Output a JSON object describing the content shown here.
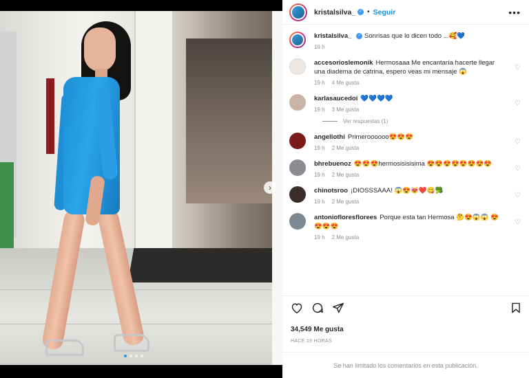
{
  "post": {
    "username": "kristalsilva_",
    "follow_label": "Seguir",
    "separator": "•",
    "verified_mark": "✓",
    "more_icon": "•••",
    "caption_text": "Sonrisas que lo dicen todo ...🥰💙",
    "caption_time": "19 h",
    "likes": "34,549 Me gusta",
    "posted_ago": "HACE 19 HORAS",
    "comments_limited": "Se han limitado los comentarios en esta publicación.",
    "carousel_next": "›"
  },
  "comments": [
    {
      "user": "accesorioslemonik",
      "text": "Hermosaaa Me encantaría hacerte llegar una diadema de catrina, espero veas mi mensaje 😱",
      "time": "19 h",
      "likes": "4 Me gusta",
      "avatar_color": "#efe6e0"
    },
    {
      "user": "karlasaucedoi",
      "text": "💙💙💙💙",
      "time": "19 h",
      "likes": "3 Me gusta",
      "avatar_color": "#c9b2a6"
    },
    {
      "user": "angellothi",
      "text": "Primeroooooo😍😍😍",
      "time": "19 h",
      "likes": "2 Me gusta",
      "avatar_color": "#7a1a1a"
    },
    {
      "user": "bhrebuenoz",
      "text": "😍😍😍hermosisisisima 😍😍😍😍😍😍😍😍",
      "time": "19 h",
      "likes": "2 Me gusta",
      "avatar_color": "#8a8a90"
    },
    {
      "user": "chinotsroo",
      "text": "¡DIOSSSAAA! 😱😍😻❤️😋🥦",
      "time": "19 h",
      "likes": "2 Me gusta",
      "avatar_color": "#3b2e28"
    },
    {
      "user": "antoniofloresflorees",
      "text": "Porque esta tan Hermosa 🤔😍😱😱 😍😍😍😍",
      "time": "19 h",
      "likes": "2 Me gusta",
      "avatar_color": "#7d8890"
    }
  ],
  "view_replies_label": "Ver respuestas (1)",
  "icons": {
    "like": "heart-outline-icon",
    "comment": "comment-icon",
    "share": "paper-plane-icon",
    "save": "bookmark-icon",
    "small_heart": "♡"
  },
  "colors": {
    "follow_blue": "#0095f6",
    "verified_blue": "#3897f0",
    "muted_gray": "#8e8e8e"
  }
}
